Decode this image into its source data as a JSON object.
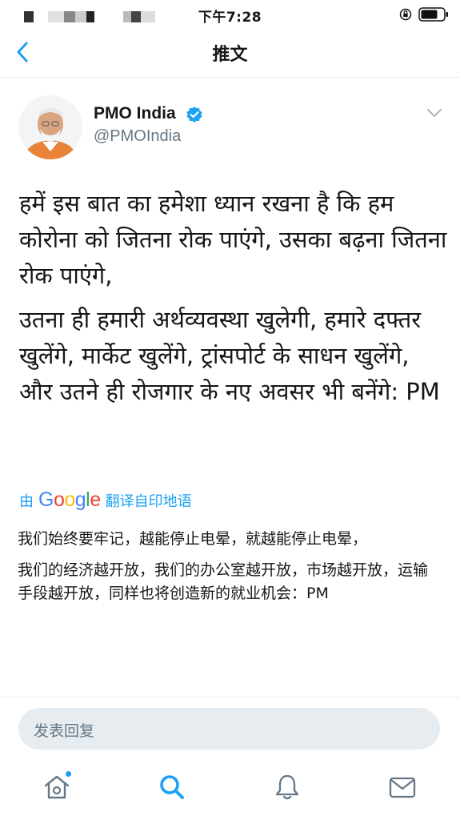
{
  "status_bar": {
    "time": "下午7:28",
    "icons": [
      "portrait-lock-icon",
      "battery-icon"
    ]
  },
  "nav": {
    "back_icon": "chevron-left-icon",
    "title": "推文"
  },
  "tweet": {
    "author_name": "PMO India",
    "verified": true,
    "handle": "@PMOIndia",
    "body": [
      "हमें इस बात का हमेशा ध्यान रखना है कि हम कोरोना को जितना रोक पाएंगे, उसका बढ़ना जितना रोक पाएंगे,",
      "उतना ही हमारी अर्थव्यवस्था खुलेगी, हमारे दफ्तर खुलेंगे, मार्केट खुलेंगे, ट्रांसपोर्ट के साधन खुलेंगे, और उतने ही रोजगार के नए अवसर भी बनेंगे: PM"
    ],
    "translate": {
      "prefix": "由",
      "provider": "Google",
      "suffix": "翻译自印地语"
    },
    "translation": [
      "我们始终要牢记，越能停止电晕，就越能停止电晕，",
      "我们的经济越开放，我们的办公室越开放，市场越开放，运输手段越开放，同样也将创造新的就业机会：PM"
    ]
  },
  "reply": {
    "placeholder": "发表回复"
  },
  "tabbar": {
    "items": [
      "home-icon",
      "search-icon",
      "notifications-icon",
      "messages-icon"
    ],
    "accent": "#1da1f2"
  },
  "colors": {
    "accent": "#1da1f2",
    "secondary_text": "#657786",
    "divider": "#e6ecf0"
  }
}
